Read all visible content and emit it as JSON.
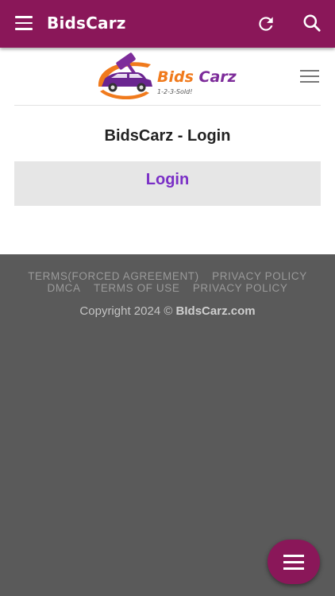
{
  "appbar": {
    "title": "BidsCarz",
    "menu_icon": "hamburger-menu-icon",
    "refresh_icon": "refresh-icon",
    "search_icon": "search-icon",
    "color": "#8a1759"
  },
  "site": {
    "logo_text": "Bids Carz",
    "logo_tagline": "1-2-3-Sold!",
    "menu_icon": "hamburger-menu-icon"
  },
  "main": {
    "title": "BidsCarz - Login",
    "login_tab_label": "Login",
    "login_color": "#7a2fc6"
  },
  "footer": {
    "links_row1": [
      "TERMS(FORCED AGREEMENT)",
      "PRIVACY POLICY"
    ],
    "links_row2": [
      "DMCA",
      "TERMS OF USE",
      "PRIVACY POLICY"
    ],
    "copyright_prefix": "Copyright 2024 ©",
    "copyright_site": "BIdsCarz.com",
    "background": "#5a5a5a"
  },
  "fab": {
    "icon": "hamburger-menu-icon"
  }
}
